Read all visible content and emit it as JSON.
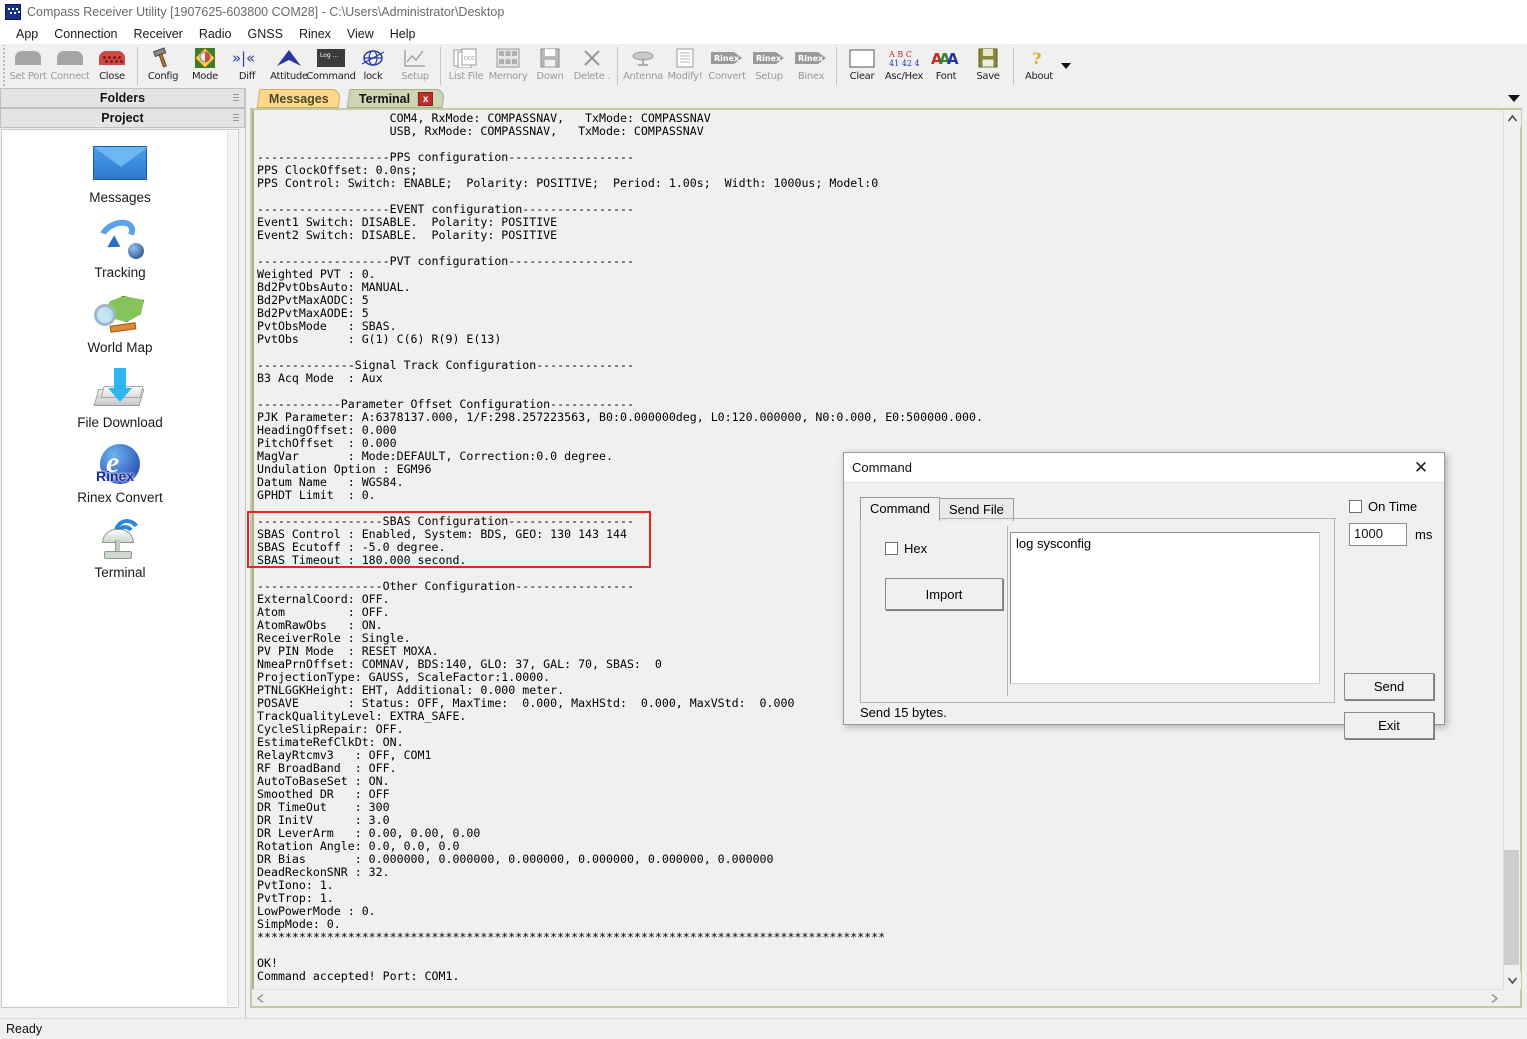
{
  "window": {
    "title": "Compass Receiver Utility [1907625-603800 COM28] - C:\\Users\\Administrator\\Desktop",
    "icon": "app-icon"
  },
  "menu": {
    "items": [
      {
        "label": "App"
      },
      {
        "label": "Connection"
      },
      {
        "label": "Receiver"
      },
      {
        "label": "Radio"
      },
      {
        "label": "GNSS"
      },
      {
        "label": "Rinex"
      },
      {
        "label": "View"
      },
      {
        "label": "Help"
      }
    ]
  },
  "toolbar": {
    "groups": [
      {
        "buttons": [
          {
            "label": "Set Port",
            "icon": "port-icon",
            "disabled": true
          },
          {
            "label": "Connect",
            "icon": "plug-icon",
            "disabled": true
          },
          {
            "label": "Close",
            "icon": "close-port-icon",
            "disabled": false
          }
        ]
      },
      {
        "buttons": [
          {
            "label": "Config",
            "icon": "hammer-icon",
            "disabled": false
          },
          {
            "label": "Mode",
            "icon": "mode-icon",
            "disabled": false
          },
          {
            "label": "Diff",
            "icon": "diff-icon",
            "disabled": false
          },
          {
            "label": "Attitude",
            "icon": "attitude-icon",
            "disabled": false
          },
          {
            "label": "Command",
            "icon": "command-log-icon",
            "disabled": false
          },
          {
            "label": "lock",
            "icon": "globe-lock-icon",
            "disabled": false
          },
          {
            "label": "Setup",
            "icon": "setup-chart-icon",
            "disabled": true
          }
        ]
      },
      {
        "buttons": [
          {
            "label": "List File",
            "icon": "list-file-icon",
            "disabled": true
          },
          {
            "label": "Memory",
            "icon": "memory-grid-icon",
            "disabled": true
          },
          {
            "label": "Down",
            "icon": "floppy-down-icon",
            "disabled": true
          },
          {
            "label": "Delete .",
            "icon": "delete-x-icon",
            "disabled": true
          }
        ]
      },
      {
        "buttons": [
          {
            "label": "Antenna",
            "icon": "antenna-icon",
            "disabled": true
          },
          {
            "label": "Modify!",
            "icon": "modify-doc-icon",
            "disabled": true
          },
          {
            "label": "Convert",
            "icon": "rinex-convert-icon",
            "disabled": true
          },
          {
            "label": "Setup",
            "icon": "rinex-setup-icon",
            "disabled": true
          },
          {
            "label": "Binex",
            "icon": "rinex-binex-icon",
            "disabled": true
          }
        ]
      },
      {
        "buttons": [
          {
            "label": "Clear",
            "icon": "clear-box-icon",
            "disabled": false
          },
          {
            "label": "Asc/Hex",
            "icon": "asc-hex-icon",
            "disabled": false
          },
          {
            "label": "Font",
            "icon": "font-aaa-icon",
            "disabled": false
          },
          {
            "label": "Save",
            "icon": "floppy-save-icon",
            "disabled": false
          }
        ]
      },
      {
        "buttons": [
          {
            "label": "About",
            "icon": "question-help-icon",
            "disabled": false
          }
        ]
      }
    ],
    "overflow_caret": "chevron-down-icon"
  },
  "sidebar": {
    "headers": [
      {
        "label": "Folders"
      },
      {
        "label": "Project"
      }
    ],
    "items": [
      {
        "label": "Messages",
        "icon": "envelope-icon"
      },
      {
        "label": "Tracking",
        "icon": "tracking-arrow-icon"
      },
      {
        "label": "World Map",
        "icon": "world-map-icon"
      },
      {
        "label": "File Download",
        "icon": "file-download-icon"
      },
      {
        "label": "Rinex Convert",
        "icon": "rinex-logo-icon"
      },
      {
        "label": "Terminal",
        "icon": "antenna-terminal-icon"
      }
    ]
  },
  "main": {
    "tabs": [
      {
        "label": "Messages",
        "active": false,
        "closable": false
      },
      {
        "label": "Terminal",
        "active": true,
        "closable": true,
        "close_label": "x"
      }
    ],
    "terminal_text": "                   COM4, RxMode: COMPASSNAV,   TxMode: COMPASSNAV\n                   USB, RxMode: COMPASSNAV,   TxMode: COMPASSNAV\n\n-------------------PPS configuration------------------\nPPS ClockOffset: 0.0ns;\nPPS Control: Switch: ENABLE;  Polarity: POSITIVE;  Period: 1.00s;  Width: 1000us; Model:0\n\n-------------------EVENT configuration----------------\nEvent1 Switch: DISABLE.  Polarity: POSITIVE\nEvent2 Switch: DISABLE.  Polarity: POSITIVE\n\n-------------------PVT configuration------------------\nWeighted PVT : 0.\nBd2PvtObsAuto: MANUAL.\nBd2PvtMaxAODC: 5\nBd2PvtMaxAODE: 5\nPvtObsMode   : SBAS.\nPvtObs       : G(1) C(6) R(9) E(13)\n\n--------------Signal Track Configuration--------------\nB3 Acq Mode  : Aux\n\n------------Parameter Offset Configuration------------\nPJK Parameter: A:6378137.000, 1/F:298.257223563, B0:0.000000deg, L0:120.000000, N0:0.000, E0:500000.000.\nHeadingOffset: 0.000\nPitchOffset  : 0.000\nMagVar       : Mode:DEFAULT, Correction:0.0 degree.\nUndulation Option : EGM96\nDatum Name   : WGS84.\nGPHDT Limit  : 0.\n\n------------------SBAS Configuration------------------\nSBAS Control : Enabled, System: BDS, GEO: 130 143 144\nSBAS Ecutoff : -5.0 degree.\nSBAS Timeout : 180.000 second.\n\n------------------Other Configuration-----------------\nExternalCoord: OFF.\nAtom         : OFF.\nAtomRawObs   : ON.\nReceiverRole : Single.\nPV PIN Mode  : RESET MOXA.\nNmeaPrnOffset: COMNAV, BDS:140, GLO: 37, GAL: 70, SBAS:  0\nProjectionType: GAUSS, ScaleFactor:1.0000.\nPTNLGGKHeight: EHT, Additional: 0.000 meter.\nPOSAVE       : Status: OFF, MaxTime:  0.000, MaxHStd:  0.000, MaxVStd:  0.000\nTrackQualityLevel: EXTRA_SAFE.\nCycleSlipRepair: OFF.\nEstimateRefClkDt: ON.\nRelayRtcmv3   : OFF, COM1\nRF BroadBand  : OFF.\nAutoToBaseSet : ON.\nSmoothed DR   : OFF\nDR TimeOut    : 300\nDR InitV      : 3.0\nDR LeverArm   : 0.00, 0.00, 0.00\nRotation Angle: 0.0, 0.0, 0.0\nDR Bias       : 0.000000, 0.000000, 0.000000, 0.000000, 0.000000, 0.000000\nDeadReckonSNR : 32.\nPvtIono: 1.\nPvtTrop: 1.\nLowPowerMode : 0.\nSimpMode: 0.\n******************************************************************************************\n\nOK!\nCommand accepted! Port: COM1.",
    "highlight_color": "#ee2222",
    "scroll_up_icon": "caret-up-icon",
    "scroll_down_icon": "caret-down-icon",
    "scroll_left_icon": "caret-left-icon",
    "scroll_right_icon": "caret-right-icon"
  },
  "dialog": {
    "title": "Command",
    "close_icon": "close-icon",
    "tabs": [
      {
        "label": "Command",
        "active": true
      },
      {
        "label": "Send File",
        "active": false
      }
    ],
    "hex_checkbox": {
      "label": "Hex",
      "checked": false
    },
    "import_button": "Import",
    "command_text": "log sysconfig",
    "on_time_checkbox": {
      "label": "On Time",
      "checked": false
    },
    "interval_value": "1000",
    "interval_unit": "ms",
    "send_button": "Send",
    "exit_button": "Exit",
    "status": "Send 15 bytes."
  },
  "statusbar": {
    "text": "Ready"
  }
}
